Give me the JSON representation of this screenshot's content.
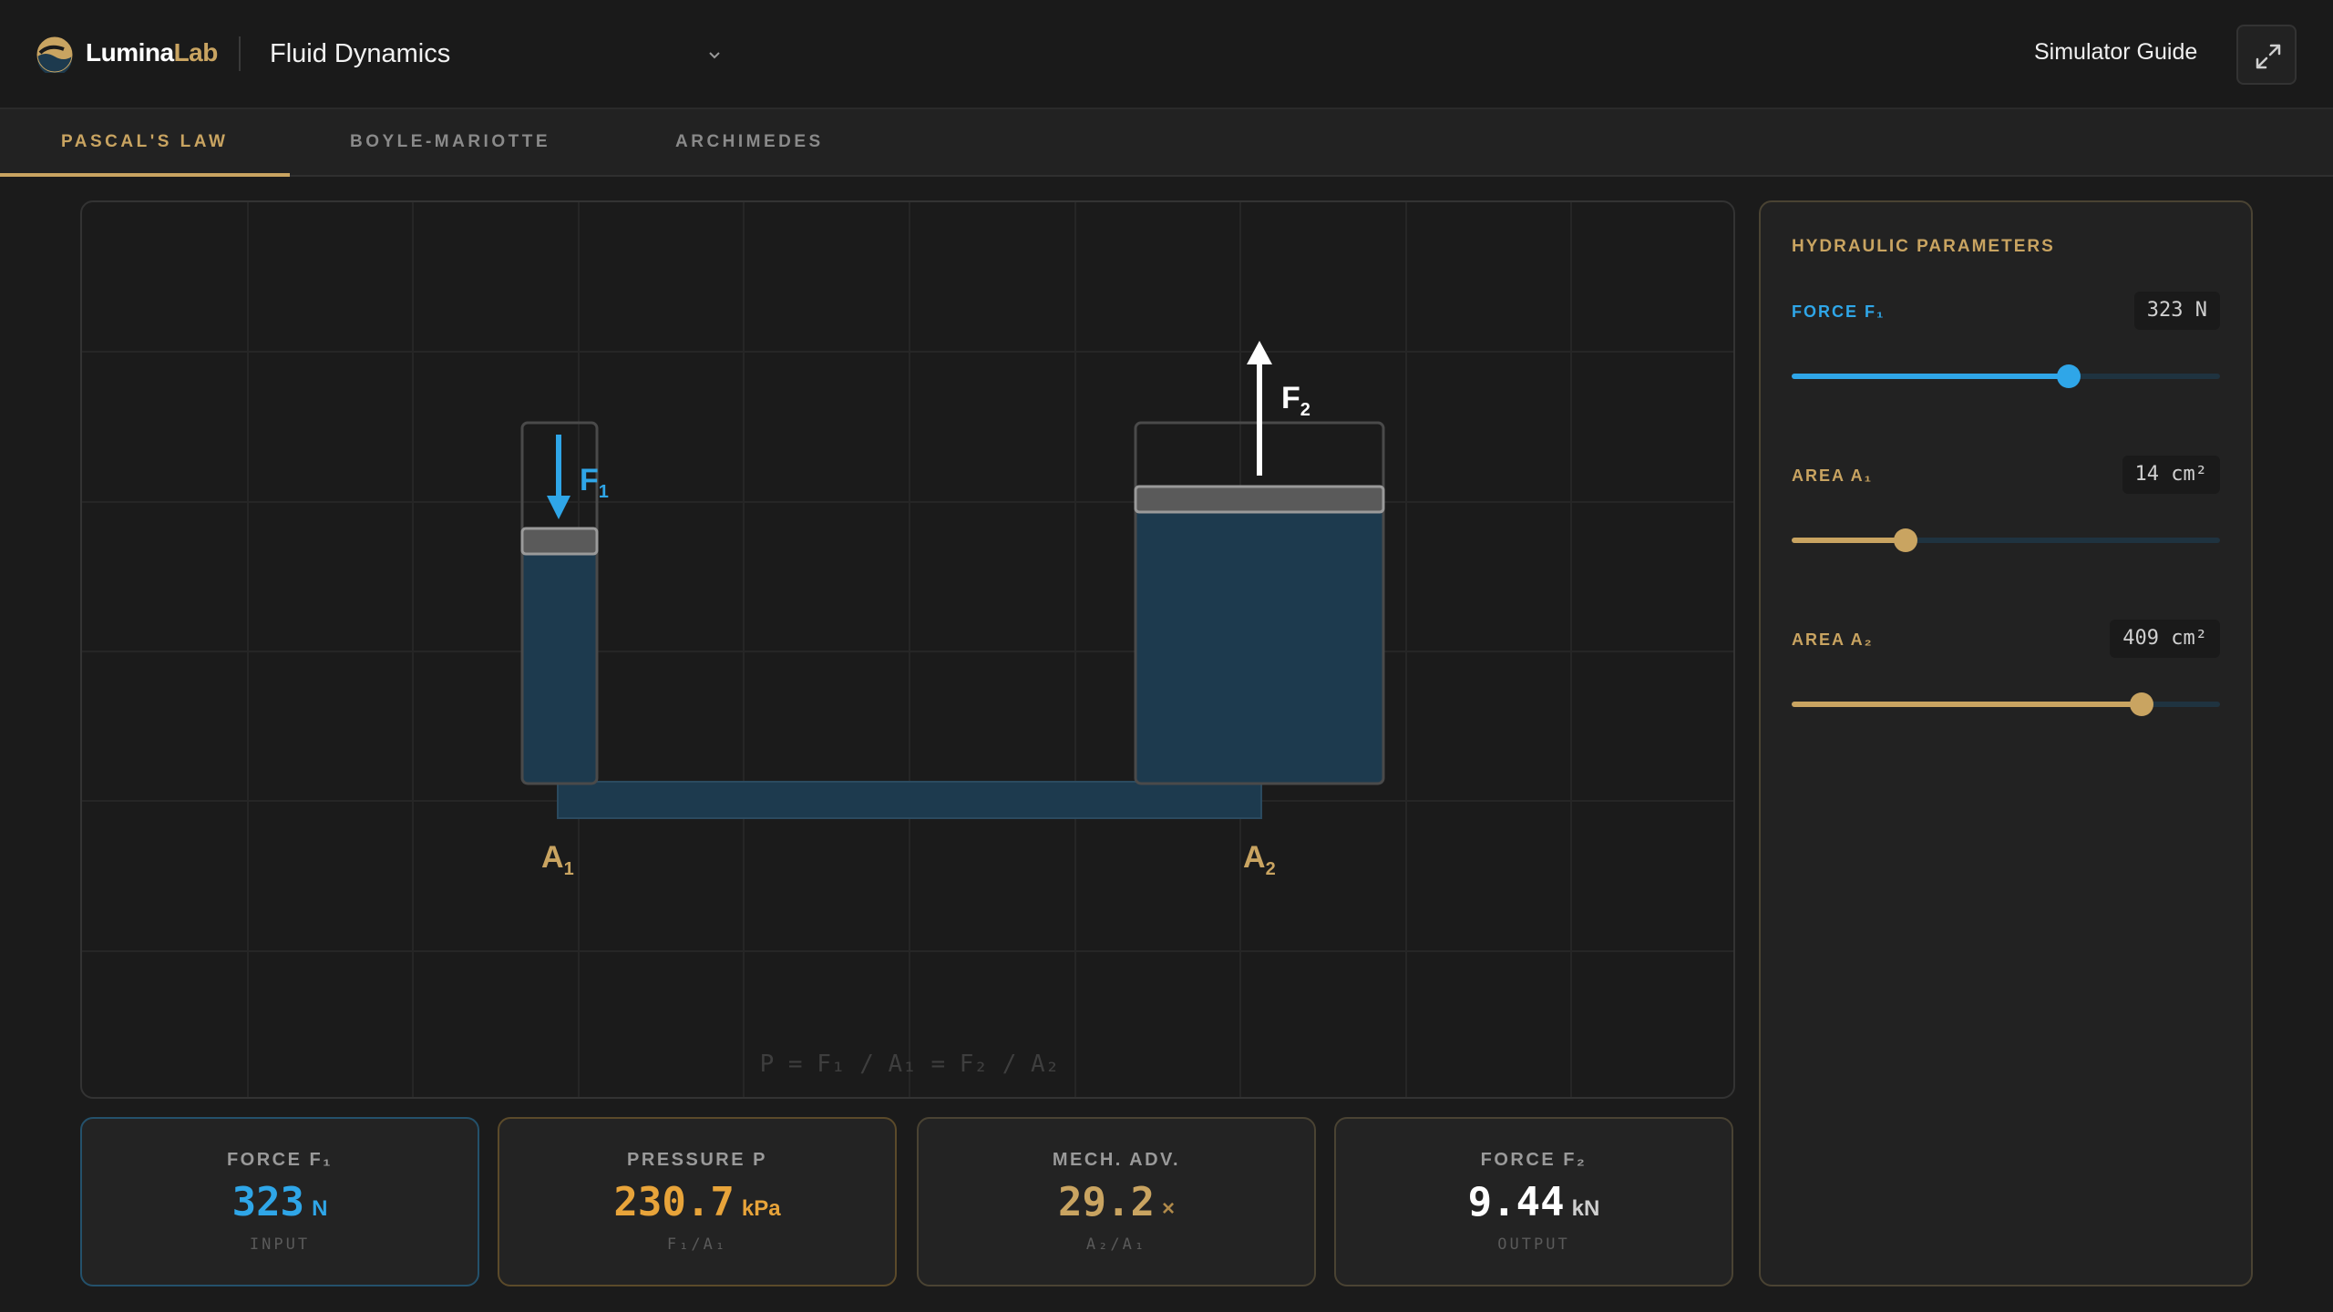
{
  "brand": {
    "part1": "Lumina",
    "part2": "Lab"
  },
  "app": {
    "title": "Fluid Dynamics"
  },
  "header": {
    "guide_label": "Simulator Guide"
  },
  "tabs": [
    {
      "label": "PASCAL'S LAW",
      "active": true
    },
    {
      "label": "BOYLE-MARIOTTE",
      "active": false
    },
    {
      "label": "ARCHIMEDES",
      "active": false
    }
  ],
  "diagram": {
    "force1_label": "F",
    "force1_sub": "1",
    "force2_label": "F",
    "force2_sub": "2",
    "area1_label": "A",
    "area1_sub": "1",
    "area2_label": "A",
    "area2_sub": "2",
    "formula": "P = F₁ / A₁ = F₂ / A₂"
  },
  "stats": {
    "force1": {
      "label": "FORCE F₁",
      "value": "323",
      "unit": "N",
      "sub": "INPUT"
    },
    "pressure": {
      "label": "PRESSURE P",
      "value": "230.7",
      "unit": "kPa",
      "sub": "F₁/A₁"
    },
    "mech_adv": {
      "label": "MECH. ADV.",
      "value": "29.2",
      "unit": "×",
      "sub": "A₂/A₁"
    },
    "force2": {
      "label": "FORCE F₂",
      "value": "9.44",
      "unit": "kN",
      "sub": "OUTPUT"
    }
  },
  "panel": {
    "title": "HYDRAULIC PARAMETERS",
    "params": {
      "force1": {
        "label": "FORCE F₁",
        "value_text": "323 N",
        "fraction": 0.646
      },
      "area1": {
        "label": "AREA A₁",
        "value_text": "14 cm²",
        "fraction": 0.266
      },
      "area2": {
        "label": "AREA A₂",
        "value_text": "409 cm²",
        "fraction": 0.818
      }
    }
  },
  "colors": {
    "accent_gold": "#c9a461",
    "accent_blue": "#2fa6e8",
    "fluid": "#1d3a4e",
    "pressure_orange": "#e8a43a"
  },
  "icons": {
    "logo": "logo-mark-icon",
    "dropdown": "chevron-down-icon",
    "expand": "expand-icon"
  }
}
